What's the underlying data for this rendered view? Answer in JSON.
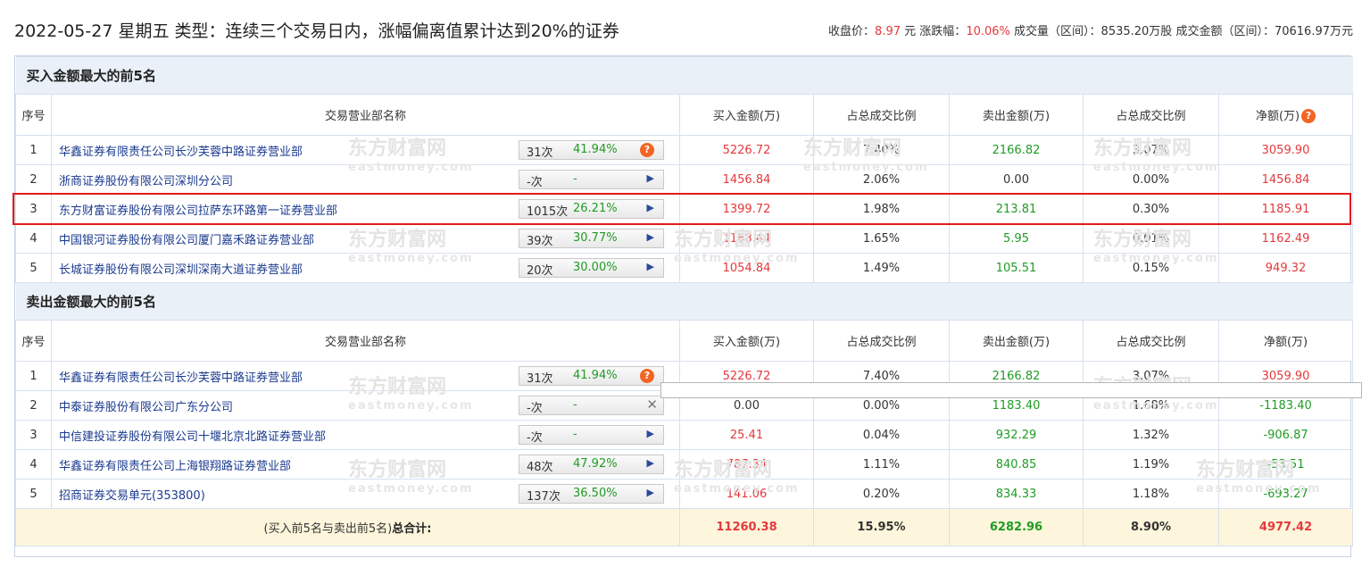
{
  "header": {
    "title": "2022-05-27 星期五 类型：连续三个交易日内，涨幅偏离值累计达到20%的证券",
    "close_label": "收盘价：",
    "close_value": "8.97",
    "close_unit": "元",
    "change_label": "涨跌幅：",
    "change_value": "10.06%",
    "volume_label": "成交量（区间）：",
    "volume_value": "8535.20万股",
    "amount_label": "成交金额（区间）：",
    "amount_value": "70616.97万元"
  },
  "columns": {
    "seq": "序号",
    "name": "交易营业部名称",
    "buy": "买入金额(万)",
    "buy_ratio": "占总成交比例",
    "sell": "卖出金额(万)",
    "sell_ratio": "占总成交比例",
    "net": "净额(万)"
  },
  "buy_section": {
    "title": "买入金额最大的前5名",
    "rows": [
      {
        "seq": "1",
        "name": "华鑫证券有限责任公司长沙芙蓉中路证券营业部",
        "count": "31次",
        "rate": "41.94%",
        "icon": "question-icon",
        "buy": "5226.72",
        "buy_ratio": "7.40%",
        "sell": "2166.82",
        "sell_ratio": "3.07%",
        "net": "3059.90"
      },
      {
        "seq": "2",
        "name": "浙商证券股份有限公司深圳分公司",
        "count": "-次",
        "rate": "-",
        "icon": "arrow-icon",
        "buy": "1456.84",
        "buy_ratio": "2.06%",
        "sell": "0.00",
        "sell_ratio": "0.00%",
        "net": "1456.84"
      },
      {
        "seq": "3",
        "name": "东方财富证券股份有限公司拉萨东环路第一证券营业部",
        "count": "1015次",
        "rate": "26.21%",
        "icon": "arrow-icon",
        "buy": "1399.72",
        "buy_ratio": "1.98%",
        "sell": "213.81",
        "sell_ratio": "0.30%",
        "net": "1185.91"
      },
      {
        "seq": "4",
        "name": "中国银河证券股份有限公司厦门嘉禾路证券营业部",
        "count": "39次",
        "rate": "30.77%",
        "icon": "arrow-icon",
        "buy": "1168.44",
        "buy_ratio": "1.65%",
        "sell": "5.95",
        "sell_ratio": "0.01%",
        "net": "1162.49"
      },
      {
        "seq": "5",
        "name": "长城证券股份有限公司深圳深南大道证券营业部",
        "count": "20次",
        "rate": "30.00%",
        "icon": "arrow-icon",
        "buy": "1054.84",
        "buy_ratio": "1.49%",
        "sell": "105.51",
        "sell_ratio": "0.15%",
        "net": "949.32"
      }
    ]
  },
  "sell_section": {
    "title": "卖出金额最大的前5名",
    "rows": [
      {
        "seq": "1",
        "name": "华鑫证券有限责任公司长沙芙蓉中路证券营业部",
        "count": "31次",
        "rate": "41.94%",
        "icon": "question-icon",
        "buy": "5226.72",
        "buy_ratio": "7.40%",
        "sell": "2166.82",
        "sell_ratio": "3.07%",
        "net": "3059.90"
      },
      {
        "seq": "2",
        "name": "中泰证券股份有限公司广东分公司",
        "count": "-次",
        "rate": "-",
        "icon": "close-icon",
        "buy": "0.00",
        "buy_ratio": "0.00%",
        "sell": "1183.40",
        "sell_ratio": "1.68%",
        "net": "-1183.40"
      },
      {
        "seq": "3",
        "name": "中信建投证券股份有限公司十堰北京北路证券营业部",
        "count": "-次",
        "rate": "-",
        "icon": "arrow-icon",
        "buy": "25.41",
        "buy_ratio": "0.04%",
        "sell": "932.29",
        "sell_ratio": "1.32%",
        "net": "-906.87"
      },
      {
        "seq": "4",
        "name": "华鑫证券有限责任公司上海银翔路证券营业部",
        "count": "48次",
        "rate": "47.92%",
        "icon": "arrow-icon",
        "buy": "787.34",
        "buy_ratio": "1.11%",
        "sell": "840.85",
        "sell_ratio": "1.19%",
        "net": "-53.51"
      },
      {
        "seq": "5",
        "name": "招商证券交易单元(353800)",
        "count": "137次",
        "rate": "36.50%",
        "icon": "arrow-icon",
        "buy": "141.06",
        "buy_ratio": "0.20%",
        "sell": "834.33",
        "sell_ratio": "1.18%",
        "net": "-693.27"
      }
    ]
  },
  "total": {
    "label_prefix": "(买入前5名与卖出前5名)",
    "label_bold": "总合计:",
    "buy": "11260.38",
    "buy_ratio": "15.95%",
    "sell": "6282.96",
    "sell_ratio": "8.90%",
    "net": "4977.42"
  },
  "watermark": {
    "text": "东方财富网",
    "subtext": "eastmoney.com"
  },
  "colors": {
    "up": "#e4393c",
    "down": "#1f9c24",
    "highlight": "#e21b1b",
    "section_bg": "#e9f0f8",
    "total_bg": "#fdf6dc"
  }
}
